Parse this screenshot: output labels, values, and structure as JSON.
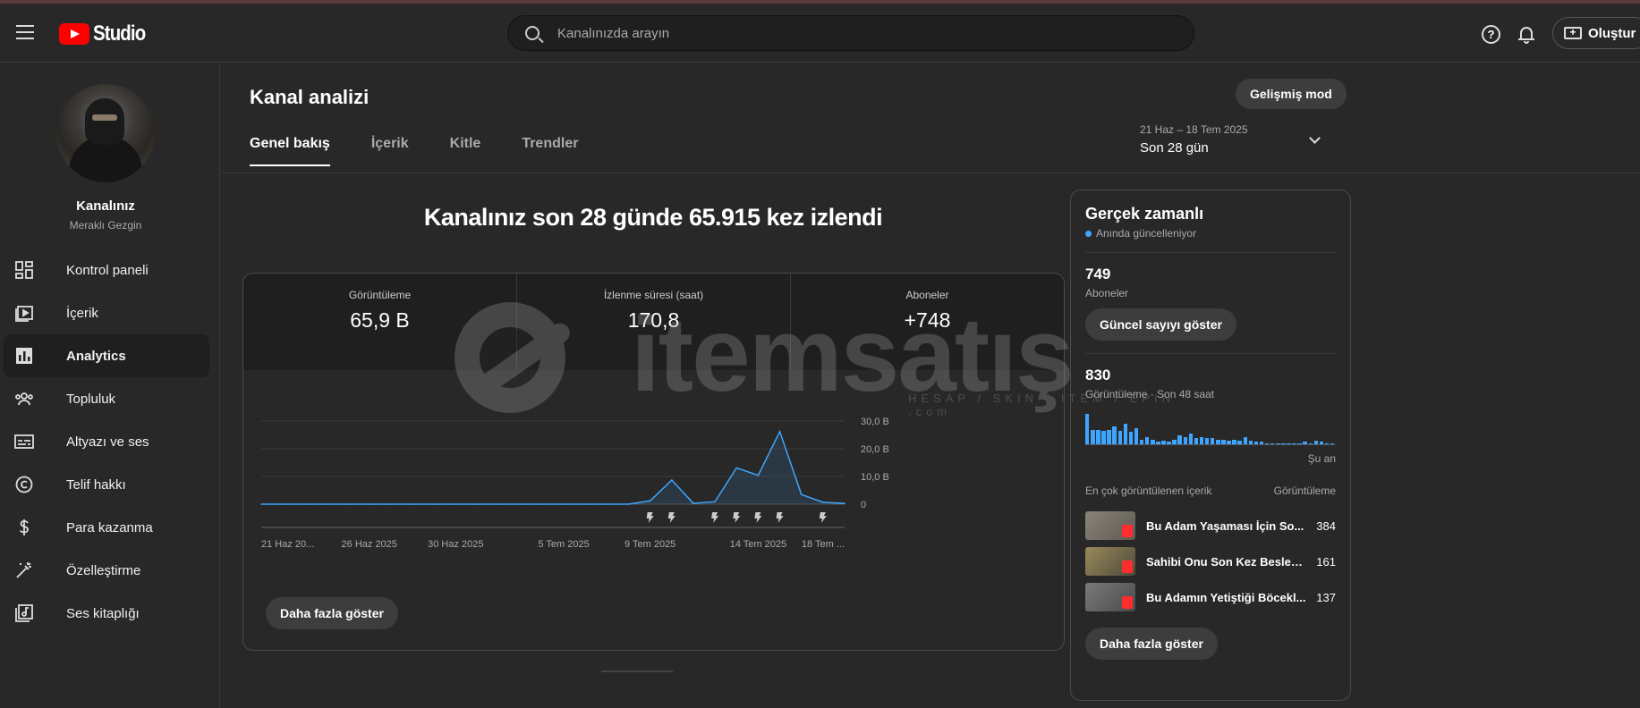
{
  "header": {
    "logo_text": "Studio",
    "search_placeholder": "Kanalınızda arayın",
    "help_label": "?",
    "create_label": "Oluştur"
  },
  "sidebar": {
    "channel_name": "Kanalınız",
    "channel_subtitle": "Meraklı Gezgin",
    "items": [
      {
        "label": "Kontrol paneli",
        "icon": "dashboard-icon"
      },
      {
        "label": "İçerik",
        "icon": "content-icon"
      },
      {
        "label": "Analytics",
        "icon": "analytics-icon",
        "active": true
      },
      {
        "label": "Topluluk",
        "icon": "community-icon"
      },
      {
        "label": "Altyazı ve ses",
        "icon": "subtitles-icon"
      },
      {
        "label": "Telif hakkı",
        "icon": "copyright-icon"
      },
      {
        "label": "Para kazanma",
        "icon": "monetization-icon"
      },
      {
        "label": "Özelleştirme",
        "icon": "customization-icon"
      },
      {
        "label": "Ses kitaplığı",
        "icon": "audio-library-icon"
      }
    ]
  },
  "main": {
    "title": "Kanal analizi",
    "advanced_mode": "Gelişmiş mod",
    "tabs": [
      "Genel bakış",
      "İçerik",
      "Kitle",
      "Trendler"
    ],
    "date_range_sub": "21 Haz – 18 Tem 2025",
    "date_range_main": "Son 28 gün",
    "headline": "Kanalınız son 28 günde 65.915 kez izlendi",
    "metrics": [
      {
        "label": "Görüntüleme",
        "value": "65,9 B"
      },
      {
        "label": "İzlenme süresi (saat)",
        "value": "170,8"
      },
      {
        "label": "Aboneler",
        "value": "+748"
      }
    ],
    "show_more": "Daha fazla göster"
  },
  "chart_data": {
    "type": "line",
    "x_tick_labels": [
      "21 Haz 20...",
      "26 Haz 2025",
      "30 Haz 2025",
      "5 Tem 2025",
      "9 Tem 2025",
      "14 Tem 2025",
      "18 Tem ..."
    ],
    "y_tick_labels": [
      "30,0 B",
      "20,0 B",
      "10,0 B",
      "0"
    ],
    "ylim": [
      0,
      30000
    ],
    "x": [
      "21 Haz",
      "22 Haz",
      "23 Haz",
      "24 Haz",
      "25 Haz",
      "26 Haz",
      "27 Haz",
      "28 Haz",
      "29 Haz",
      "30 Haz",
      "1 Tem",
      "2 Tem",
      "3 Tem",
      "4 Tem",
      "5 Tem",
      "6 Tem",
      "7 Tem",
      "8 Tem",
      "9 Tem",
      "10 Tem",
      "11 Tem",
      "12 Tem",
      "13 Tem",
      "14 Tem",
      "15 Tem",
      "16 Tem",
      "17 Tem",
      "18 Tem"
    ],
    "series": [
      {
        "values": [
          0,
          0,
          0,
          0,
          0,
          0,
          0,
          0,
          0,
          0,
          0,
          0,
          0,
          0,
          0,
          0,
          0,
          0,
          1200,
          8700,
          300,
          900,
          13100,
          10400,
          26200,
          3500,
          700,
          300
        ]
      }
    ],
    "marker_dates": [
      "9 Tem",
      "10 Tem",
      "12 Tem",
      "13 Tem",
      "14 Tem",
      "15 Tem",
      "17 Tem"
    ],
    "grid": true,
    "color": "#3ea6ff"
  },
  "realtime": {
    "title": "Gerçek zamanlı",
    "live_text": "Anında güncelleniyor",
    "subscribers_value": "749",
    "subscribers_label": "Aboneler",
    "show_current": "Güncel sayıyı göster",
    "views_value": "830",
    "views_label": "Görüntüleme · Son 48 saat",
    "now_label": "Şu an",
    "bar_values": [
      25,
      12,
      12,
      11,
      12,
      15,
      11,
      17,
      10,
      13,
      4,
      6,
      4,
      2,
      3,
      2,
      4,
      7,
      6,
      9,
      5,
      6,
      5,
      5,
      4,
      4,
      3,
      4,
      3,
      6,
      3,
      2,
      2,
      1,
      1,
      1,
      1,
      1,
      1,
      1,
      2,
      1,
      3,
      2,
      1,
      1
    ],
    "top_content_label": "En çok görüntülenen içerik",
    "views_col_label": "Görüntüleme",
    "videos": [
      {
        "title": "Bu Adam Yaşaması İçin So...",
        "views": "384"
      },
      {
        "title": "Sahibi Onu Son Kez Besled...",
        "views": "161"
      },
      {
        "title": "Bu Adamın Yetiştiği Böcekl...",
        "views": "137"
      }
    ],
    "show_more": "Daha fazla göster"
  },
  "watermark": {
    "text": "itemsatış",
    "sub": "HESAP / SKIN / ITEM / EPIN",
    "domain": ".com"
  }
}
